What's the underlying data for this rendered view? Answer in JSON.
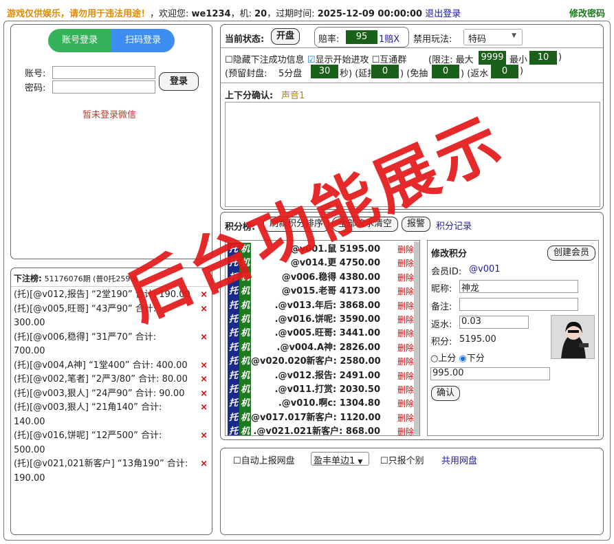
{
  "topbar": {
    "warning": "游戏仅供娱乐，请勿用于违法用途！",
    "welcome_prefix": "，欢迎您:",
    "username": "we1234",
    "machine_label": "，机:",
    "machine_no": "20",
    "expire_label": "，过期时间:",
    "expire_time": "2025-12-09 00:00:00",
    "logout": "退出登录",
    "change_pwd": "修改密码"
  },
  "login": {
    "tab_account": "账号登录",
    "tab_qr": "扫码登录",
    "account_label": "账号:",
    "password_label": "密码:",
    "login_button": "登录",
    "wechat_status": "暂未登录微信"
  },
  "bets": {
    "title": "下注榜:",
    "period": "51176076期 (普0托2590)",
    "rows": [
      {
        "text": "(托)[@v012,报告] “2堂190” 合计: 190.00"
      },
      {
        "text": "(托)[@v005,旺哥] “43严90” 合计:"
      },
      {
        "text": "300.00"
      },
      {
        "text": "(托)[@v006,稳得] “31严70” 合计:"
      },
      {
        "text": "700.00"
      },
      {
        "text": "(托)[@v004,A神] “1堂400” 合计: 400.00"
      },
      {
        "text": "(托)[@v002,笔者] “2严3/80” 合计: 80.00"
      },
      {
        "text": "(托)[@v003,狠人] “24严90” 合计: 90.00"
      },
      {
        "text": "(托)[@v003,狠人] “21角140” 合计:"
      },
      {
        "text": "140.00"
      },
      {
        "text": "(托)[@v016,饼呢] “12严500” 合计:"
      },
      {
        "text": "500.00"
      },
      {
        "text": "(托)[@v021,021新客户] “13角190” 合计:"
      },
      {
        "text": "190.00"
      }
    ]
  },
  "status": {
    "current_label": "当前状态:",
    "state_button": "开盘",
    "odds_label": "赔率:",
    "odds_value": "95",
    "odds_suffix": "1赔X",
    "banned_label": "禁用玩法:",
    "banned_select": "特码",
    "hide_success": "隐藏下注成功信息",
    "show_start": "显示开始进攻",
    "mutual_group": "互通群",
    "limit_label": "(限注: 最大",
    "limit_max": "9999",
    "limit_min_label": "最小",
    "limit_min": "10",
    "limit_close": ")",
    "reserve_label": "(预留封盘:",
    "five_min": "5分盘",
    "five_value": "30",
    "sec_label": "秒) (延报",
    "delay_value": "0",
    "waive_label": ") (免抽",
    "waive_value": "0",
    "rebate_label": ") (返水",
    "rebate_value": "0",
    "rebate_close": ")",
    "confirm_label": "上下分确认:",
    "sound_label": "声音1"
  },
  "score": {
    "title": "积分榜:",
    "refresh_sort": "刷新积分排序",
    "clear_all": "全部流水清空",
    "alarm": "报警",
    "score_log": "积分记录",
    "tag_tuo": "托",
    "tag_ji": "机",
    "delete_label": "删除",
    "rows": [
      {
        "name": "@v001.鼠",
        "amount": "5195.00"
      },
      {
        "name": "@v014.更",
        "amount": "4750.00"
      },
      {
        "name": "@v006.稳得",
        "amount": "4380.00"
      },
      {
        "name": "@v015.老哥",
        "amount": "4173.00"
      },
      {
        "name": ".@v013.年后:",
        "amount": "3868.00"
      },
      {
        "name": ".@v016.饼呢:",
        "amount": "3590.00"
      },
      {
        "name": ".@v005.旺哥:",
        "amount": "3441.00"
      },
      {
        "name": ".@v004.A神:",
        "amount": "2826.00"
      },
      {
        "name": "@v020.020新客户:",
        "amount": "2580.00"
      },
      {
        "name": ".@v012.报告:",
        "amount": "2491.00"
      },
      {
        "name": ".@v011.打赏:",
        "amount": "2030.50"
      },
      {
        "name": ".@v010.啊c:",
        "amount": "1304.80"
      },
      {
        "name": "@v017.017新客户:",
        "amount": "1120.00"
      },
      {
        "name": ".@v021.021新客户:",
        "amount": "868.00"
      }
    ]
  },
  "modify": {
    "title": "修改积分",
    "create_member": "创建会员",
    "member_id_label": "会员ID:",
    "member_id": "@v001",
    "nickname_label": "昵称:",
    "nickname": "神龙",
    "remark_label": "备注:",
    "remark": "",
    "rebate_label": "返水:",
    "rebate_value": "0.03",
    "points_label": "积分:",
    "points_value": "5195.00",
    "up_label": "上分",
    "down_label": "下分",
    "amount_value": "995.00",
    "confirm": "确认"
  },
  "bottom": {
    "auto_report": "自动上报网盘",
    "select_value": "盈丰单边1",
    "only_report": "只报个别",
    "shared_disk": "共用网盘"
  },
  "watermark": "后台功能展示",
  "colors": {
    "warning": "#e08a00",
    "green_field": "#1a5f1a",
    "tab_green": "#35b35a",
    "tab_blue": "#3d8ef0",
    "tag_blue": "#1a2a8c",
    "tag_green": "#1e7a1e",
    "delete_red": "#dd0000",
    "watermark_red": "#e31a1a"
  }
}
